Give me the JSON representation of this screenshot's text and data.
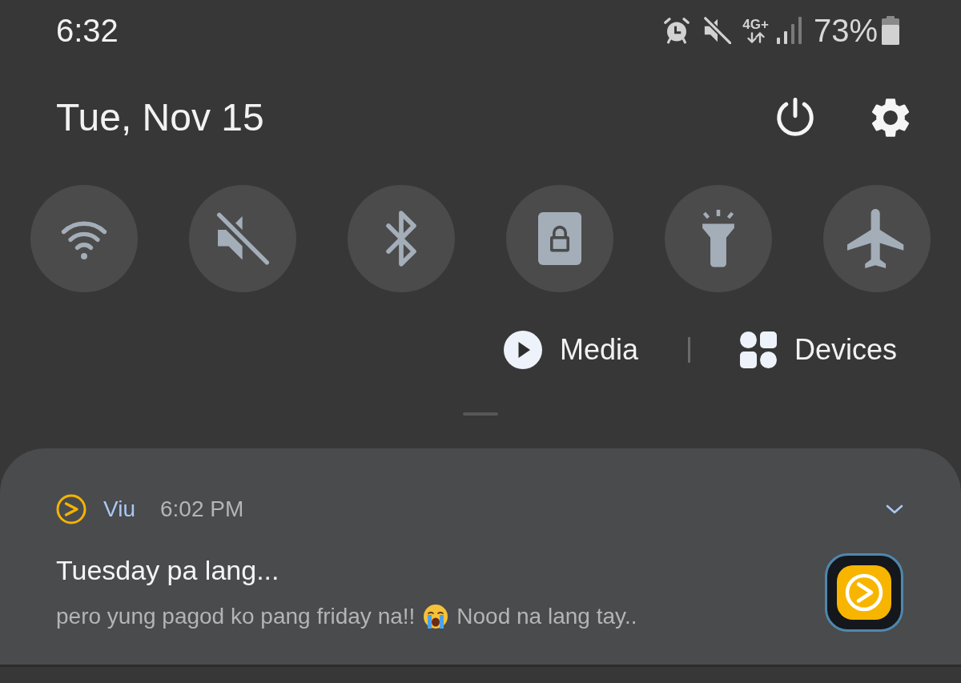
{
  "status_bar": {
    "time": "6:32",
    "network_type": "4G+",
    "battery": "73%"
  },
  "header": {
    "date": "Tue, Nov 15"
  },
  "quick_toggles": [
    {
      "kind": "wifi",
      "on": false
    },
    {
      "kind": "sound",
      "on": false
    },
    {
      "kind": "bluetooth",
      "on": false
    },
    {
      "kind": "lock",
      "on": false
    },
    {
      "kind": "flashlight",
      "on": false
    },
    {
      "kind": "airplane",
      "on": false
    }
  ],
  "media_row": {
    "media_label": "Media",
    "devices_label": "Devices"
  },
  "notification": {
    "app": "Viu",
    "time": "6:02 PM",
    "expanded": false,
    "title": "Tuesday pa lang...",
    "body": [
      {
        "kind": "text",
        "text": "pero yung pagod ko pang friday na!!"
      },
      {
        "kind": "emoji"
      },
      {
        "kind": "text",
        "text": "Nood na lang tay.."
      }
    ]
  }
}
